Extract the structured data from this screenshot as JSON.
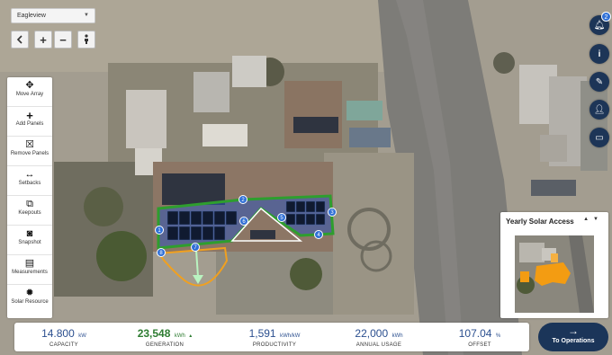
{
  "imagery_source": {
    "value": "Eagleview"
  },
  "zoom": {
    "back_icon": "chevron-left-icon",
    "zoom_in": "+",
    "zoom_out": "−",
    "pegman_icon": "street-view-icon"
  },
  "tools": [
    {
      "label": "Move Array",
      "icon": "move-icon"
    },
    {
      "label": "Add Panels",
      "icon": "plus-icon"
    },
    {
      "label": "Remove Panels",
      "icon": "remove-box-icon"
    },
    {
      "label": "Setbacks",
      "icon": "horizontal-arrows-icon"
    },
    {
      "label": "Keepouts",
      "icon": "keepout-icon"
    },
    {
      "label": "Snapshot",
      "icon": "camera-icon"
    },
    {
      "label": "Measurements",
      "icon": "ruler-icon"
    },
    {
      "label": "Solar Resource",
      "icon": "sun-icon"
    }
  ],
  "right_buttons": {
    "notifications_badge": "2",
    "icons": [
      "bell-icon",
      "info-icon",
      "edit-icon",
      "add-user-icon",
      "document-icon"
    ]
  },
  "segment_labels": [
    "1",
    "2",
    "3",
    "4",
    "5",
    "6",
    "7",
    "8"
  ],
  "yearly_solar_access": {
    "title": "Yearly Solar Access",
    "prev": "▲",
    "next": "▼"
  },
  "stats": {
    "capacity": {
      "value": "14.800",
      "unit": "kW",
      "label": "CAPACITY"
    },
    "generation": {
      "value": "23,548",
      "unit": "kWh",
      "label": "GENERATION"
    },
    "productivity": {
      "value": "1,591",
      "unit": "kWh/kW",
      "label": "PRODUCTIVITY"
    },
    "annual_usage": {
      "value": "22,000",
      "unit": "kWh",
      "label": "ANNUAL USAGE"
    },
    "offset": {
      "value": "107.04",
      "unit": "%",
      "label": "OFFSET"
    }
  },
  "to_operations": {
    "label": "To Operations",
    "arrow": "→"
  },
  "colors": {
    "navy": "#1b3559",
    "accent_blue": "#2f6fd6",
    "roof_outline": "#2e9e2e",
    "setback": "#f0a020",
    "generation_green": "#2e7d32"
  }
}
